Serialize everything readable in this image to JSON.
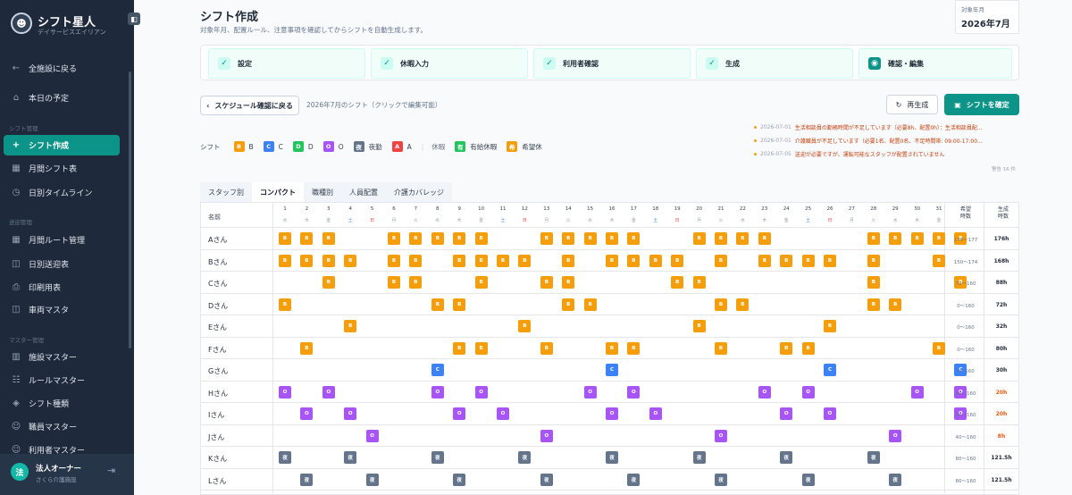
{
  "app": {
    "name": "シフト星人",
    "subtitle": "デイサービスエイリアン"
  },
  "sidebar": {
    "back": "全施設に戻る",
    "today": "本日の予定",
    "sections": [
      "シフト管理",
      "送迎管理",
      "マスター管理"
    ],
    "shift_items": [
      "シフト作成",
      "月間シフト表",
      "日別タイムライン"
    ],
    "transport_items": [
      "月間ルート管理",
      "日別送迎表",
      "印刷用表",
      "車両マスタ"
    ],
    "master_items": [
      "施設マスター",
      "ルールマスター",
      "シフト種類",
      "職員マスター",
      "利用者マスター"
    ],
    "user": {
      "avatar": "法",
      "name": "法人オーナー",
      "org": "さくら介護施設"
    }
  },
  "page": {
    "title": "シフト作成",
    "subtitle": "対象年月、配置ルール、注意事項を確認してからシフトを自動生成します。"
  },
  "month": {
    "label": "対象年月",
    "value": "2026年7月"
  },
  "steps": [
    "設定",
    "休暇入力",
    "利用者確認",
    "生成",
    "確認・編集"
  ],
  "actions": {
    "back": "スケジュール確認に戻る",
    "note": "2026年7月のシフト（クリックで編集可能）",
    "regenerate": "再生成",
    "confirm": "シフトを確定"
  },
  "alerts": [
    {
      "time": "2026-07-01",
      "text": "生活相談員の勤務時間が不足しています（必要8h、配置0h）：生活相談員配..."
    },
    {
      "time": "2026-07-01",
      "text": "介護職員が不足しています（必要1名、配置0名、不足時間帯: 09:00-17:00..."
    },
    {
      "time": "2026-07-05",
      "text": "送迎が必要ですが、運転可能なスタッフが配置されていません"
    }
  ],
  "alerts_footer": "警告 16 件",
  "legend": {
    "label": "シフト",
    "items": [
      {
        "code": "B",
        "name": "B",
        "color": "#f59e0b"
      },
      {
        "code": "C",
        "name": "C",
        "color": "#3b82f6"
      },
      {
        "code": "D",
        "name": "D",
        "color": "#22c55e"
      },
      {
        "code": "O",
        "name": "O",
        "color": "#a855f7"
      },
      {
        "code": "夜",
        "name": "夜勤",
        "color": "#64748b"
      },
      {
        "code": "A",
        "name": "A",
        "color": "#ef4444"
      }
    ],
    "leave_label": "休暇",
    "leave_items": [
      {
        "code": "有",
        "name": "有給休暇",
        "color": "#22c55e"
      },
      {
        "code": "希",
        "name": "希望休",
        "color": "#f59e0b"
      }
    ]
  },
  "tabs": [
    "スタッフ別",
    "コンパクト",
    "職種別",
    "人員配置",
    "介護カバレッジ"
  ],
  "grid": {
    "name_header": "名前",
    "hours_header": "希望\n時数",
    "actual_header": "生成\n時数",
    "weekdays": [
      "水",
      "木",
      "金",
      "土",
      "日",
      "月",
      "火",
      "水",
      "木",
      "金",
      "土",
      "日",
      "月",
      "火",
      "水",
      "木",
      "金",
      "土",
      "日",
      "月",
      "火",
      "水",
      "木",
      "金",
      "土",
      "日",
      "月",
      "火",
      "水",
      "木",
      "金"
    ],
    "staff": [
      {
        "name": "Aさん",
        "hours": "174〜177",
        "actual": "176h",
        "warn": false,
        "shifts": "BBB..BBBBB..BBBBB..BBBB....BBBBB"
      },
      {
        "name": "Bさん",
        "hours": "150〜174",
        "actual": "168h",
        "warn": false,
        "shifts": "BBBB.BB.BBBB.B.BBBB.B.BBBB.B..B."
      },
      {
        "name": "Cさん",
        "hours": "72〜160",
        "actual": "88h",
        "warn": false,
        "shifts": "..B..BB..B..BB....BB.......B...B"
      },
      {
        "name": "Dさん",
        "hours": "0〜160",
        "actual": "72h",
        "warn": false,
        "shifts": "B......BB....BB.....BB.....BB..."
      },
      {
        "name": "Eさん",
        "hours": "0〜160",
        "actual": "32h",
        "warn": false,
        "shifts": "...B.......B.......B.....B......"
      },
      {
        "name": "Fさん",
        "hours": "0〜160",
        "actual": "80h",
        "warn": false,
        "shifts": ".B......BB..B..BB...B..BB.....B."
      },
      {
        "name": "Gさん",
        "hours": "0〜160",
        "actual": "30h",
        "warn": false,
        "shifts": ".......C.......C.........C.....C"
      },
      {
        "name": "Hさん",
        "hours": "40〜160",
        "actual": "20h",
        "warn": true,
        "shifts": "O.O....O.O....O.O.....O.O....O.O"
      },
      {
        "name": "Iさん",
        "hours": "40〜160",
        "actual": "20h",
        "warn": true,
        "shifts": ".O.O....O.O....O.O.....O.O.....O"
      },
      {
        "name": "Jさん",
        "hours": "40〜160",
        "actual": "8h",
        "warn": true,
        "shifts": "....O.......O.......O.......O..."
      },
      {
        "name": "Kさん",
        "hours": "80〜160",
        "actual": "121.5h",
        "warn": false,
        "shifts": "夜..夜...夜...夜...夜...夜...夜...夜"
      },
      {
        "name": "Lさん",
        "hours": "80〜160",
        "actual": "121.5h",
        "warn": false,
        "shifts": ".夜..夜...夜...夜...夜...夜...夜...夜"
      }
    ]
  },
  "colors": {
    "B": "#f59e0b",
    "C": "#3b82f6",
    "O": "#a855f7",
    "夜": "#64748b",
    "accent": "#0d9488"
  }
}
